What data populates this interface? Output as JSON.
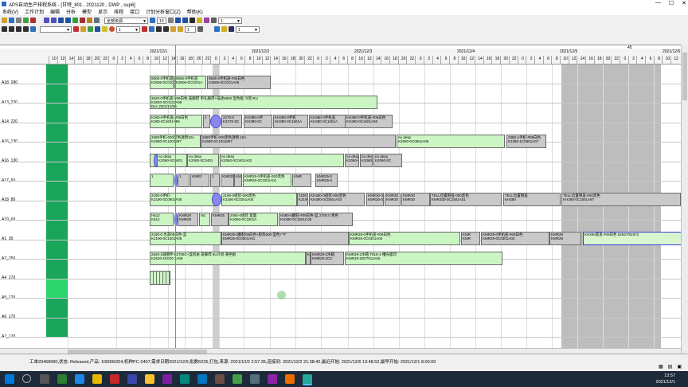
{
  "window": {
    "title": "APS自动生产排程系统 - [甘特_801 , 2021120 , DWP , sup6]",
    "min": "—",
    "max": "☐",
    "close": "✕"
  },
  "menu": [
    "系统(V)",
    "工作计划",
    "编辑",
    "分析",
    "模型",
    "显示",
    "排程",
    "接口",
    "计划分析窗口(Z)",
    "帮助(K)"
  ],
  "toolbar": {
    "resource_group": "全部资源",
    "spin1": "10",
    "spin2": "1",
    "spin3": "1",
    "spin4": "1",
    "spin5": "1"
  },
  "timeline": {
    "days": [
      "2021/12/1",
      "2021/12/2",
      "2021/12/3",
      "2021/12/4",
      "2021/12/5",
      "2021/12/6"
    ],
    "hours": [
      "10",
      "12",
      "14",
      "16",
      "18",
      "20",
      "22",
      "0",
      "2",
      "4",
      "6",
      "8",
      "10",
      "12",
      "14",
      "16",
      "18",
      "20",
      "22",
      "0",
      "2",
      "4",
      "6",
      "8",
      "10",
      "12",
      "14",
      "16",
      "18",
      "20",
      "22",
      "0",
      "2",
      "4",
      "6",
      "8",
      "10",
      "12",
      "14",
      "16",
      "18",
      "20",
      "22",
      "0",
      "2",
      "4",
      "6",
      "8",
      "10",
      "12",
      "14",
      "16",
      "18",
      "20",
      "22",
      "0",
      "2",
      "4",
      "6",
      "8",
      "10",
      "12",
      "14",
      "16",
      "18",
      "20",
      "22",
      "0",
      "2",
      "4",
      "6",
      "8",
      "10",
      "12",
      "14"
    ],
    "marker": "45"
  },
  "rows": [
    {
      "name": "A18_280",
      "bars": [
        {
          "c": "g",
          "t": "9506-0手机盖-RI\nK3506-0C0101A"
        },
        {
          "c": "g",
          "t": "9506-0手机盖\nK3506-0C0101A"
        },
        {
          "c": "gr",
          "t": "9506-0手机盖-#09白色\nK3506-0C0101A05"
        }
      ]
    },
    {
      "name": "A13_220",
      "bars": [
        {
          "c": "g",
          "t": "2620-0手机盖-#09白色 盖脚焊 单孔脚焊+描述6800 型色框 冷装:RU\nK2620-0C0121A08\nDec 2021/12/06"
        }
      ]
    },
    {
      "name": "A14_220",
      "bars": [
        {
          "c": "g",
          "t": "K360-0手机盖-#09白色\nK380-0C1601A59"
        },
        {
          "c": "gr",
          "t": "1"
        },
        {
          "c": "bl",
          "t": ""
        },
        {
          "c": "gr",
          "t": "2270-0\nK2270-0C"
        },
        {
          "c": "gr",
          "t": "KH380-0手\nKH380-0C"
        },
        {
          "c": "gr",
          "t": "KH380-0手机\nKH380-0C1601A"
        },
        {
          "c": "gr",
          "t": "KH380-0手机盖\nKH380-0C1601A"
        },
        {
          "c": "gr",
          "t": "KH380-0手机盖-#09白色\nKH380-0C1601A59"
        }
      ]
    },
    {
      "name": "A16_130",
      "bars": [
        {
          "c": "g",
          "t": "2680手机-000黑色透明10A\nK2680-0C1001897"
        },
        {
          "c": "gr",
          "t": "2680手机-000黑色透明 10A\nK2680-0C1001897"
        },
        {
          "c": "g",
          "t": "no desp\nK2060-0C0601A06"
        },
        {
          "c": "gr",
          "t": "2380-1手机-#09白色\nK2380-1C0601A07"
        }
      ]
    },
    {
      "name": "A16_130",
      "bars": [
        {
          "c": "g",
          "t": ""
        },
        {
          "c": "bl",
          "t": ""
        },
        {
          "c": "g",
          "t": "no desp\nK2060-0C0401"
        },
        {
          "c": "g",
          "t": "no desp\nK2060-0C0401"
        },
        {
          "c": "g",
          "t": "no desp\nK2060-0C0401A02"
        },
        {
          "c": "gr",
          "t": "no desp\nK2060-0C"
        },
        {
          "c": "gr",
          "t": "no desp\nK2060-0C"
        },
        {
          "c": "gr",
          "t": "no desp\nK2060-0C"
        }
      ]
    },
    {
      "name": "A17_60",
      "bars": [
        {
          "c": "g",
          "t": "1"
        },
        {
          "c": "bl",
          "t": ""
        },
        {
          "c": "gr",
          "t": "1"
        },
        {
          "c": "gr",
          "t": "KMR2"
        },
        {
          "c": "gr",
          "t": "1"
        },
        {
          "c": "gr",
          "t": "KMR25"
        },
        {
          "c": "gr",
          "t": "KMR25-0"
        },
        {
          "c": "g",
          "t": "KMR25-0手机盖-000黑色\nKMR25-0C2201A01"
        },
        {
          "c": "gr",
          "t": "KMR"
        },
        {
          "c": "gr",
          "t": "KMR25-0\nKMR25-0"
        }
      ]
    },
    {
      "name": "A18_80",
      "bars": [
        {
          "c": "g",
          "t": "2190-0手机-\nK2190-0C0601A08"
        },
        {
          "c": "bl",
          "t": ""
        },
        {
          "c": "g",
          "t": "2190-0组装-000黑色\nK2190-0C0201A05"
        },
        {
          "c": "gr",
          "t": "2190\nK2190"
        },
        {
          "c": "gr",
          "t": "KH380-0组装-000黑色\nKH380-0C0601A03"
        },
        {
          "c": "gr",
          "t": "KMR30-0\nKMR30-0C"
        },
        {
          "c": "gr",
          "t": "KMR30\nKMR30"
        },
        {
          "c": "gr",
          "t": "KMR30\nKMR30"
        },
        {
          "c": "gr",
          "t": "TELL位置侧盖-000黑色\nKMR330-0C1501A01"
        },
        {
          "c": "gr",
          "t": "TELL位置侧盖\nKH380"
        },
        {
          "c": "gr",
          "t": "TELL位置侧盖-000黑色\nKH380-0C1501A97"
        }
      ]
    },
    {
      "name": "A19_60",
      "bars": [
        {
          "c": "g",
          "t": "H512\nK512"
        },
        {
          "c": "bl",
          "t": ""
        },
        {
          "c": "gr",
          "t": "KMR29\nKMR29"
        },
        {
          "c": "g",
          "t": "M1"
        },
        {
          "c": "gr",
          "t": "KMR25"
        },
        {
          "c": "g",
          "t": "2060-0组装 直面\nK2060-0C1501A"
        },
        {
          "c": "gr",
          "t": "H380-0翻轻-#09白色-蓝 2700.0 青色\nKH380-0C1601C06"
        }
      ]
    },
    {
      "name": "A1_30",
      "bars": [
        {
          "c": "g",
          "t": "2190-0 水盖09白色-蓝\nK2190-0C1401A05"
        },
        {
          "c": "gr",
          "t": "KMR26-0翻轻09白色+胶料600 型色+\"#\"\nKMR26-0C0601A01"
        },
        {
          "c": "g",
          "t": "KMR28-0手机盖-#09白色\nKMR28-0C0301A03"
        },
        {
          "c": "gr",
          "t": "KMR\nKMR"
        },
        {
          "c": "gr",
          "t": "KMR29-0手机盖-#09白色\nKMR29-0C0301A03"
        },
        {
          "c": "gr",
          "t": "KMR29\nKMR29"
        },
        {
          "c": "sel",
          "t": "KH390底盖 #09白色 52937/91973"
        }
      ]
    },
    {
      "name": "A2_250",
      "bars": [
        {
          "c": "g",
          "t": "2620-1展钢件-52708C+蓝机关 盖脚焊 8U冷装 黄色框\nK2620-1K020 1A08"
        },
        {
          "c": "gr",
          "t": "KMR29"
        },
        {
          "c": "gr",
          "t": "KMR29-2水箱\nKMR29-2C0"
        },
        {
          "c": "g",
          "t": "KMR29-2水箱 T815-1-槽光面印\nKMR29-2D07011A05"
        }
      ]
    },
    {
      "name": "A4_170",
      "bars": [
        {
          "c": "g",
          "t": ""
        }
      ]
    },
    {
      "name": "A5_170",
      "bars": []
    },
    {
      "name": "A6_170",
      "bars": []
    },
    {
      "name": "A7_170",
      "bars": []
    }
  ],
  "status": {
    "text": "工单20468990,状态: Released,产品: 100006204,机种PC-2407,需求日期2021/12/9,批数6235,打包,来源: 2021/12/2 2:57:35,连接到: 2021/12/2 21:38:42,最迟开始: 2021/12/6 13:48:52,最早开始: 2021/12/1 8:00:00"
  },
  "taskbar": {
    "time": "13:57",
    "date": "2021/12/1"
  },
  "colors": {
    "row_green": "#19a55a",
    "bar_green": "#ccf5c4",
    "bar_gray": "#c9c9c9",
    "bar_blue": "#8a86f0",
    "marker": "#d15bd8"
  }
}
